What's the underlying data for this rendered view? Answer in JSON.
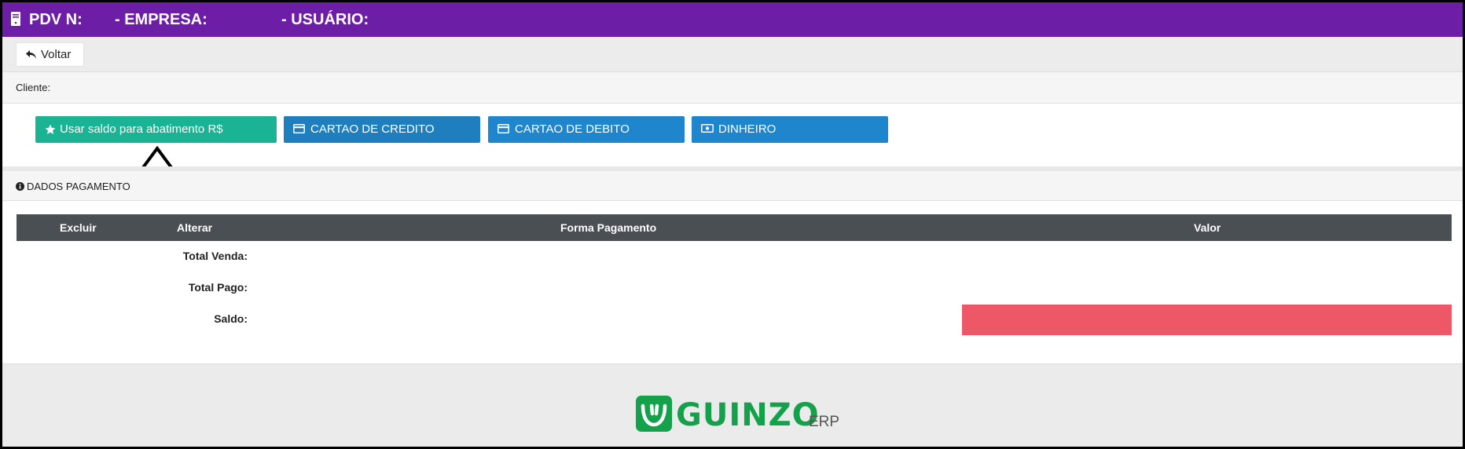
{
  "header": {
    "pdv_label": "PDV N:",
    "empresa_label": "- EMPRESA:",
    "usuario_label": "- USUÁRIO:",
    "bg_color": "#6c1ea6"
  },
  "toolbar": {
    "back_label": "Voltar",
    "back_icon": "reply-arrow-icon"
  },
  "cliente": {
    "label": "Cliente:"
  },
  "payment_buttons": [
    {
      "label": "Usar saldo para abatimento R$",
      "icon": "star-icon",
      "color": "#1ab394"
    },
    {
      "label": "CARTAO DE CREDITO",
      "icon": "credit-card-icon",
      "color": "#1f7fbe"
    },
    {
      "label": "CARTAO DE DEBITO",
      "icon": "debit-card-icon",
      "color": "#1f85cc"
    },
    {
      "label": "DINHEIRO",
      "icon": "money-icon",
      "color": "#1f85cc"
    }
  ],
  "dados": {
    "title": "DADOS PAGAMENTO",
    "icon": "info-circle-icon"
  },
  "table": {
    "headers": [
      "Excluir",
      "Alterar",
      "Forma Pagamento",
      "Valor"
    ],
    "totals": [
      {
        "label": "Total Venda:",
        "value": ""
      },
      {
        "label": "Total Pago:",
        "value": ""
      },
      {
        "label": "Saldo:",
        "value": ""
      }
    ],
    "saldo_color": "#ee5766"
  },
  "footer": {
    "logo_text": "GUINZO",
    "logo_suffix": "ERP",
    "brand_color": "#13a14a"
  }
}
